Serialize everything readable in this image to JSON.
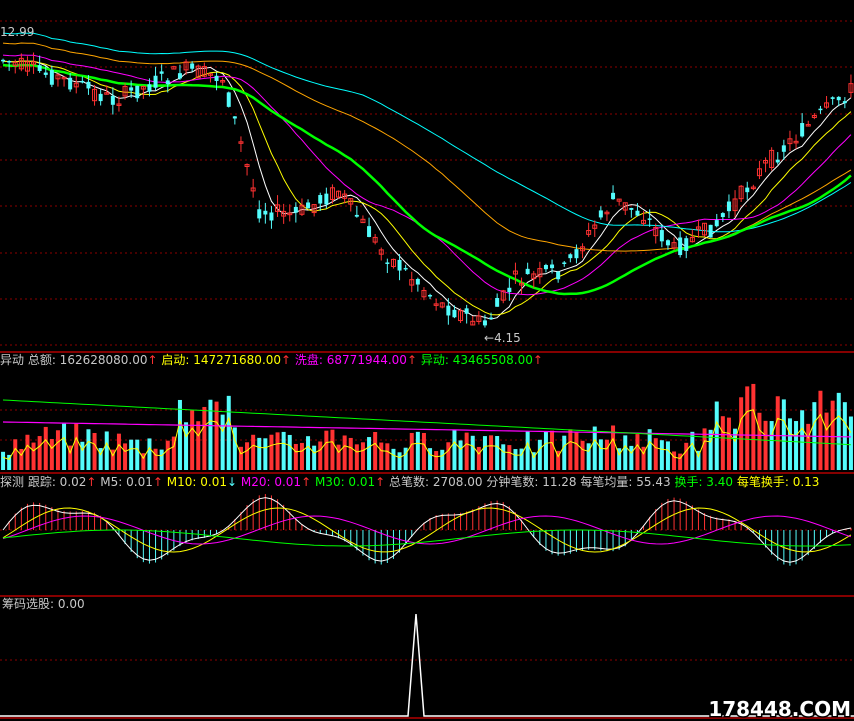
{
  "chart_data": [
    {
      "type": "candlestick",
      "panel": "price",
      "price_high_label": "12.99",
      "price_low_label": "4.15",
      "colors": {
        "up": "#ff3232",
        "down": "#54fcfc",
        "ma5": "#ffffff",
        "ma10": "#ffff00",
        "ma20": "#ff00ff",
        "ma30": "#00ff00",
        "ma60": "#ffa500",
        "ma120": "#00ffff",
        "grid": "#8b0000",
        "frame": "#b20000"
      }
    },
    {
      "type": "bar",
      "panel": "volume",
      "indicator": "异动",
      "items": [
        {
          "label": "总额",
          "value": "162628080.00",
          "arrow": "↑",
          "color": "#c8c8c8"
        },
        {
          "label": "启动",
          "value": "147271680.00",
          "arrow": "↑",
          "color": "#ffff00"
        },
        {
          "label": "洗盘",
          "value": "68771944.00",
          "arrow": "↑",
          "color": "#ff00ff"
        },
        {
          "label": "异动",
          "value": "43465508.00",
          "arrow": "↑",
          "color": "#00ff00"
        }
      ]
    },
    {
      "type": "line",
      "panel": "oscillator",
      "indicator": "探测",
      "items": [
        {
          "label": "跟踪",
          "value": "0.02",
          "arrow": "↑",
          "color": "#c8c8c8"
        },
        {
          "label": "M5",
          "value": "0.01",
          "arrow": "↑",
          "color": "#c8c8c8"
        },
        {
          "label": "M10",
          "value": "0.01",
          "arrow": "↓",
          "color": "#ffff00"
        },
        {
          "label": "M20",
          "value": "0.01",
          "arrow": "↑",
          "color": "#ff00ff"
        },
        {
          "label": "M30",
          "value": "0.01",
          "arrow": "↑",
          "color": "#00ff00"
        },
        {
          "label": "总笔数",
          "value": "2708.00",
          "arrow": "",
          "color": "#c8c8c8"
        },
        {
          "label": "分钟笔数",
          "value": "11.28",
          "arrow": "",
          "color": "#c8c8c8"
        },
        {
          "label": "每笔均量",
          "value": "55.43",
          "arrow": "",
          "color": "#c8c8c8"
        },
        {
          "label": "换手",
          "value": "3.40",
          "arrow": "",
          "color": "#00ff00"
        },
        {
          "label": "每笔换手",
          "value": "0.13",
          "arrow": "",
          "color": "#ffff00"
        }
      ]
    },
    {
      "type": "line",
      "panel": "signal",
      "indicator": "筹码选股",
      "value": "0.00"
    }
  ],
  "watermark": "178448.COM"
}
